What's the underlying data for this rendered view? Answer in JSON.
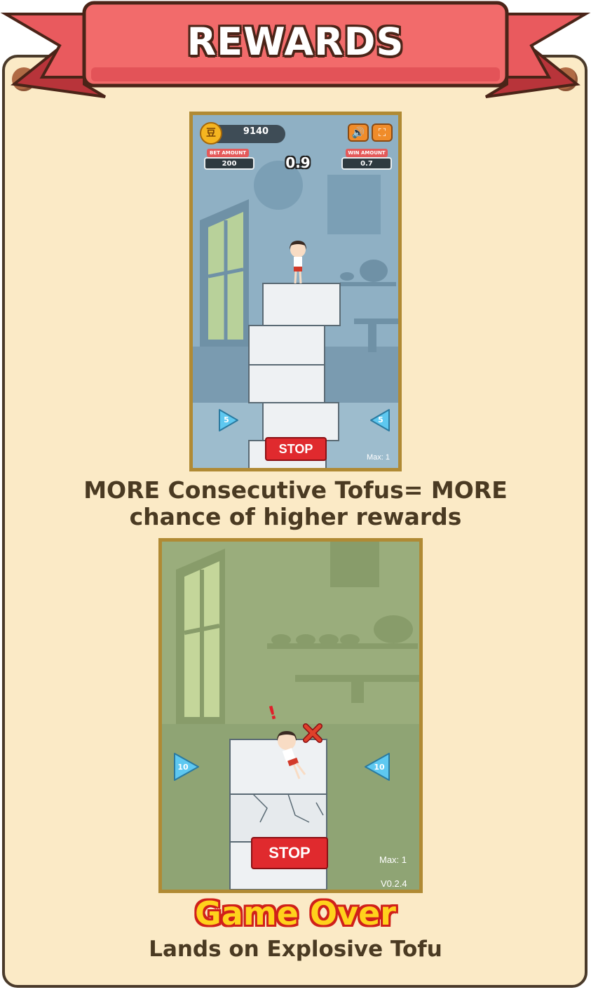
{
  "header": {
    "title": "REWARDS"
  },
  "screenshot1": {
    "coin_symbol": "豆",
    "coin_balance": "9140",
    "bet_label": "BET AMOUNT",
    "bet_value": "200",
    "multiplier": "0.9",
    "win_label": "WIN AMOUNT",
    "win_value": "0.7",
    "left_arrow_value": "5",
    "right_arrow_value": "5",
    "stop_label": "STOP",
    "max_label": "Max: 1"
  },
  "caption1": {
    "line1": "MORE Consecutive Tofus= MORE",
    "line2": "chance of higher rewards"
  },
  "screenshot2": {
    "left_arrow_value": "10",
    "right_arrow_value": "10",
    "stop_label": "STOP",
    "max_label": "Max: 1",
    "version": "V0.2.4",
    "alert": "!"
  },
  "gameover": {
    "title": "Game Over",
    "subtitle": "Lands on Explosive Tofu"
  },
  "colors": {
    "board": "#fbeac6",
    "ribbon": "#f26b6b",
    "frame": "#b08a34",
    "stop": "#e02a2e",
    "gameover_fill": "#ffd21c",
    "gameover_stroke": "#d0201a"
  }
}
